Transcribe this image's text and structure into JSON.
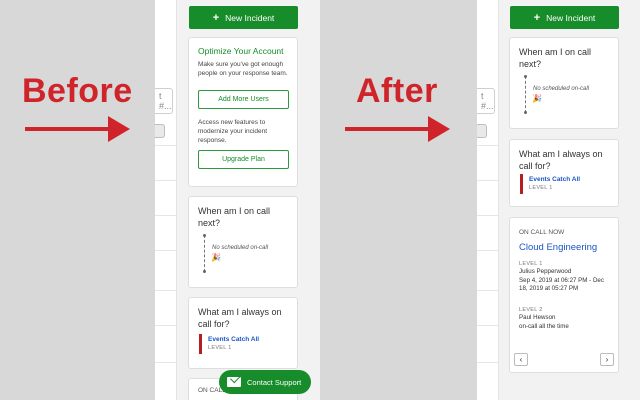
{
  "labels": {
    "before": "Before",
    "after": "After"
  },
  "left": {
    "search_fragment": "t #...",
    "new_incident": "New Incident",
    "optimize": {
      "title": "Optimize Your Account",
      "text": "Make sure you've got enough people on your response team.",
      "add_users": "Add More Users",
      "text2": "Access new features to modernize your incident response.",
      "upgrade": "Upgrade Plan"
    },
    "when_on_call": {
      "title": "When am I on call next?",
      "empty": "No scheduled on-call",
      "emoji": "🎉"
    },
    "always_on_call": {
      "title": "What am I always on call for?",
      "service": "Events Catch All",
      "level": "LEVEL 1"
    },
    "on_call_fragment": "ON CALL",
    "contact_support": "Contact Support"
  },
  "right": {
    "search_fragment": "t #...",
    "new_incident": "New Incident",
    "when_on_call": {
      "title": "When am I on call next?",
      "empty": "No scheduled on-call",
      "emoji": "🎉"
    },
    "always_on_call": {
      "title": "What am I always on call for?",
      "service": "Events Catch All",
      "level": "LEVEL 1"
    },
    "on_call_now": {
      "heading": "ON CALL NOW",
      "team": "Cloud Engineering",
      "level1": "LEVEL 1",
      "person1": "Julius Pepperwood",
      "dates1": "Sep 4, 2019 at 06:27 PM - Dec 18, 2019 at 05:27 PM",
      "level2": "LEVEL 2",
      "person2": "Paul Hewson",
      "status2": "on-call all the time",
      "prev": "‹",
      "next": "›"
    }
  },
  "colors": {
    "accent": "#168c2a",
    "label_red": "#d0242b",
    "link": "#1a56c3"
  }
}
